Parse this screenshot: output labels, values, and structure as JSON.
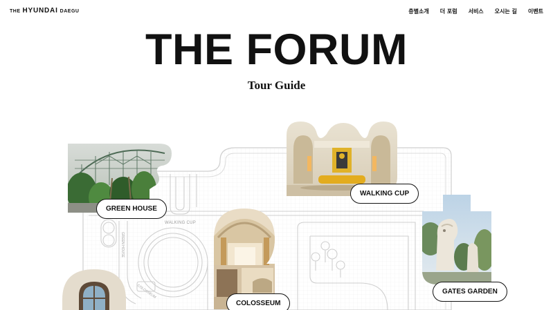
{
  "header": {
    "logo": {
      "prefix": "THE",
      "brand": "HYUNDAI",
      "city": "DAEGU"
    },
    "nav": [
      "층별소개",
      "더 포럼",
      "서비스",
      "오시는 길",
      "이벤트"
    ]
  },
  "hero": {
    "title": "THE FORUM",
    "subtitle": "Tour Guide"
  },
  "locations": {
    "green_house": "GREEN HOUSE",
    "walking_cup": "WALKING CUP",
    "colosseum": "COLOSSEUM",
    "gates_garden": "GATES GARDEN"
  },
  "map_labels": {
    "walking_cup_small": "WALKING CUP",
    "green_house_small": "GREEN HOUSE",
    "colosseum_small": "COLOSSEUM"
  },
  "colors": {
    "ink": "#111111",
    "map_line": "#c9c9c9",
    "map_grid": "#eeeeee",
    "accent_yellow": "#e0b22a"
  }
}
